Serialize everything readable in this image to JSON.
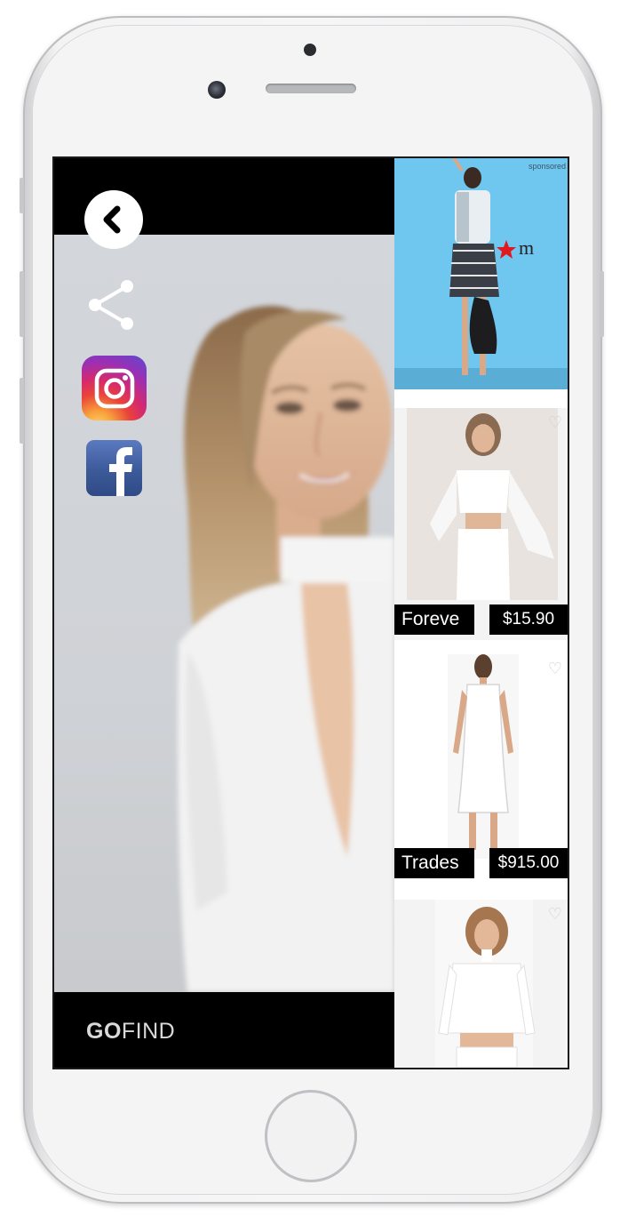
{
  "app": {
    "logo_go": "GO",
    "logo_find": "FIND"
  },
  "actions": {
    "back_icon": "chevron-left-icon",
    "share_icon": "share-icon",
    "instagram_icon": "instagram-icon",
    "facebook_icon": "facebook-icon"
  },
  "sponsored": {
    "label": "sponsored",
    "brand_mark": "macy's star logo"
  },
  "products": [
    {
      "name": "Foreve",
      "price": "$15.90"
    },
    {
      "name": "Trades",
      "price": "$915.00"
    },
    {
      "name": "",
      "price": ""
    }
  ],
  "colors": {
    "frame": "#f3f3f4",
    "screen_bar": "#000000",
    "sponsored_bg": "#6fc7ef",
    "tag_bg": "#000000",
    "logo_text": "#d9d9d9"
  }
}
